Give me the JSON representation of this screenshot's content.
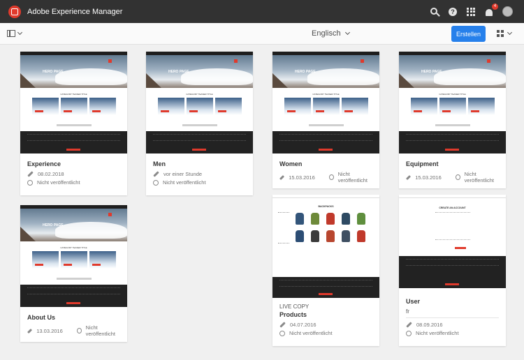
{
  "header": {
    "app_title": "Adobe Experience Manager",
    "notification_count": "4",
    "icons": [
      "search-icon",
      "help-icon",
      "solutions-icon",
      "bell-icon",
      "user-avatar"
    ]
  },
  "actionbar": {
    "language_label": "Englisch",
    "create_label": "Erstellen"
  },
  "colors": {
    "accent": "#2680eb",
    "brand": "#e03a2c",
    "topbar": "#323232"
  },
  "cards": [
    {
      "title": "Experience",
      "modified": "08.02.2018",
      "status": "Nicht veröffentlicht"
    },
    {
      "title": "Men",
      "modified": "vor einer Stunde",
      "status": "Nicht veröffentlicht"
    },
    {
      "title": "Women",
      "modified": "15.03.2016",
      "status": "Nicht veröffentlicht"
    },
    {
      "title": "Equipment",
      "modified": "15.03.2016",
      "status": "Nicht veröffentlicht"
    },
    {
      "title": "About Us",
      "modified": "13.03.2016",
      "status": "Nicht veröffentlicht"
    },
    {
      "subtitle": "LIVE COPY",
      "title": "Products",
      "modified": "04.07.2016",
      "status": "Nicht veröffentlicht"
    },
    {
      "title": "User",
      "subtitle": "fr",
      "modified": "08.09.2016",
      "status": "Nicht veröffentlicht"
    }
  ],
  "thumbnails": {
    "hero_text": "HERO PAGE",
    "teaser_title": "CATEGORY TEASER TITLE",
    "find_store": "FIND A STORE",
    "products_title": "BACKPACKS",
    "account_title": "CREATE AN ACCOUNT"
  }
}
